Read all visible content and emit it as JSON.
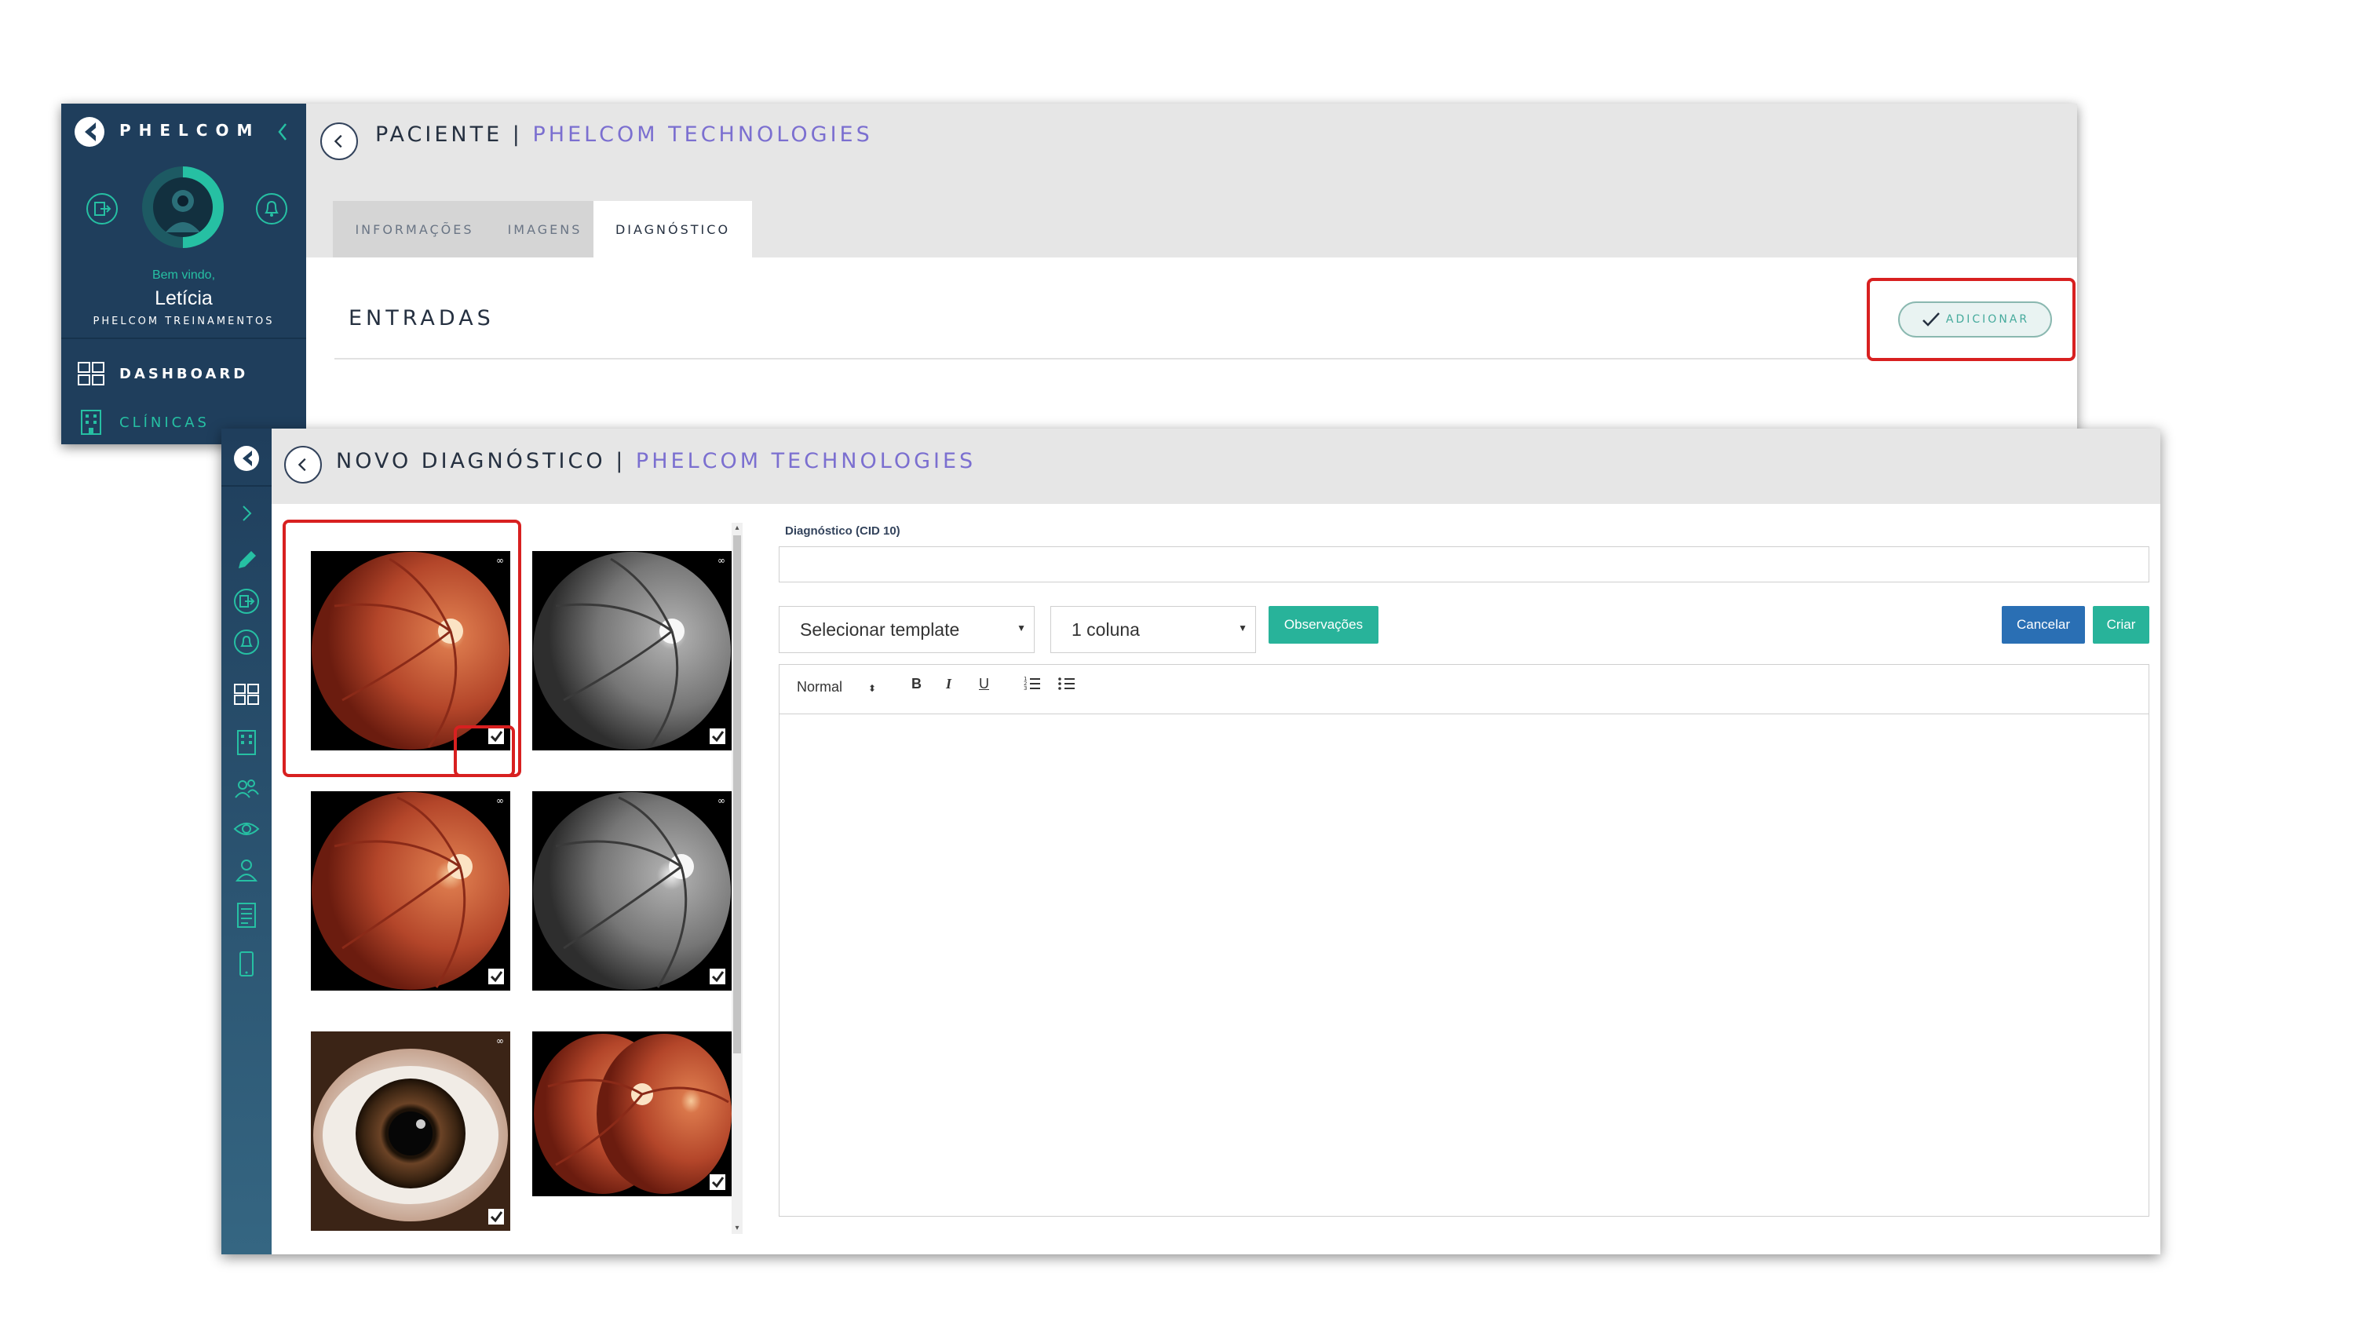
{
  "colors": {
    "sidebar": "#1f3e5c",
    "accent_teal": "#26c0a3",
    "subtitle_purple": "#7b6fd0",
    "header_grey": "#e6e6e6",
    "highlight_red": "#d82020",
    "cancel_blue": "#2a6fb4",
    "create_teal": "#28b39a"
  },
  "back_window": {
    "sidebar": {
      "brand": "PHELCOM",
      "welcome": "Bem vindo,",
      "user_name": "Letícia",
      "organization": "PHELCOM TREINAMENTOS",
      "nav": [
        {
          "label": "DASHBOARD",
          "icon": "dashboard-icon"
        },
        {
          "label": "CLÍNICAS",
          "icon": "building-icon"
        }
      ]
    },
    "header": {
      "title": "PACIENTE",
      "separator": "|",
      "subtitle": "PHELCOM TECHNOLOGIES"
    },
    "tabs": [
      {
        "label": "INFORMAÇÕES",
        "active": false
      },
      {
        "label": "IMAGENS",
        "active": false
      },
      {
        "label": "DIAGNÓSTICO",
        "active": true
      }
    ],
    "section_title": "ENTRADAS",
    "add_button": "ADICIONAR"
  },
  "front_window": {
    "header": {
      "title": "NOVO DIAGNÓSTICO",
      "separator": "|",
      "subtitle": "PHELCOM TECHNOLOGIES"
    },
    "sidebar_icons": [
      "expand-chevron-icon",
      "pencil-icon",
      "logout-icon",
      "bell-icon",
      "dashboard-icon",
      "building-icon",
      "users-icon",
      "eye-icon",
      "person-icon",
      "report-icon",
      "mobile-device-icon"
    ],
    "images": [
      {
        "type": "retina-color",
        "checked": true,
        "tag": "∞"
      },
      {
        "type": "retina-redfree",
        "checked": true,
        "tag": "∞"
      },
      {
        "type": "retina-color",
        "checked": true,
        "tag": "∞"
      },
      {
        "type": "retina-redfree",
        "checked": true,
        "tag": "∞"
      },
      {
        "type": "anterior-eye",
        "checked": true,
        "tag": "∞"
      },
      {
        "type": "retina-panorama",
        "checked": true,
        "tag": ""
      }
    ],
    "form": {
      "cid_label": "Diagnóstico (CID 10)",
      "cid_value": "",
      "template_select": "Selecionar template",
      "columns_select": "1 coluna",
      "observations_button": "Observações",
      "cancel_button": "Cancelar",
      "create_button": "Criar",
      "editor": {
        "format_select": "Normal",
        "bold": "B",
        "italic": "I",
        "underline": "U",
        "content": ""
      }
    }
  }
}
